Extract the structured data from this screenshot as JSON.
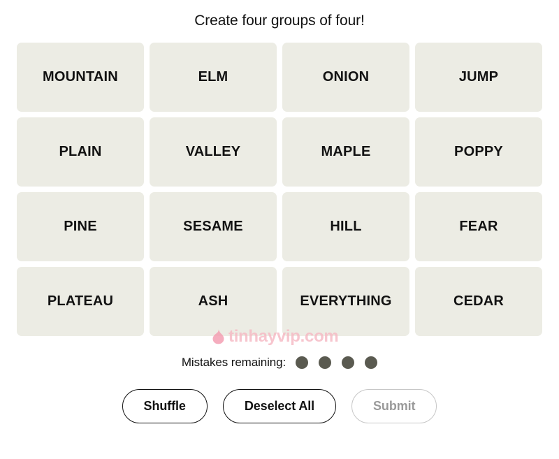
{
  "header": {
    "instruction": "Create four groups of four!"
  },
  "grid": {
    "tiles": [
      {
        "label": "MOUNTAIN"
      },
      {
        "label": "ELM"
      },
      {
        "label": "ONION"
      },
      {
        "label": "JUMP"
      },
      {
        "label": "PLAIN"
      },
      {
        "label": "VALLEY"
      },
      {
        "label": "MAPLE"
      },
      {
        "label": "POPPY"
      },
      {
        "label": "PINE"
      },
      {
        "label": "SESAME"
      },
      {
        "label": "HILL"
      },
      {
        "label": "FEAR"
      },
      {
        "label": "PLATEAU"
      },
      {
        "label": "ASH"
      },
      {
        "label": "EVERYTHING"
      },
      {
        "label": "CEDAR"
      }
    ],
    "tile_color": "#ECECE4"
  },
  "watermark": {
    "text": "tinhayvip.com",
    "icon": "flame-icon",
    "color": "#F6B9C4"
  },
  "mistakes": {
    "label": "Mistakes remaining:",
    "remaining": 4,
    "dots": [
      1,
      2,
      3,
      4
    ],
    "dot_color": "#5A5A50"
  },
  "actions": {
    "shuffle_label": "Shuffle",
    "deselect_label": "Deselect All",
    "submit_label": "Submit",
    "submit_disabled": true
  }
}
